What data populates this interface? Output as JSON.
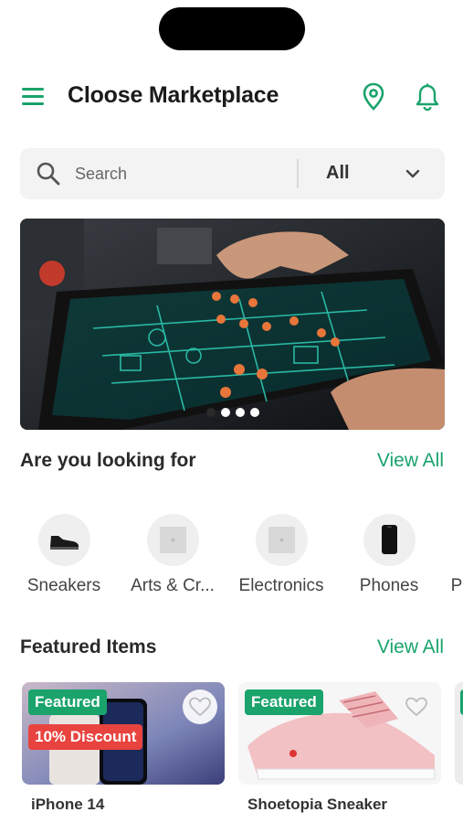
{
  "app": {
    "title": "Cloose Marketplace"
  },
  "search": {
    "placeholder": "Search",
    "category": "All"
  },
  "banner": {
    "slides": 4,
    "active_slide": 1
  },
  "categories_section": {
    "title": "Are you looking for",
    "view_all": "View All",
    "items": [
      {
        "label": "Sneakers",
        "icon": "sneaker-icon"
      },
      {
        "label": "Arts & Cr...",
        "icon": "image-placeholder-icon"
      },
      {
        "label": "Electronics",
        "icon": "image-placeholder-icon"
      },
      {
        "label": "Phones",
        "icon": "phone-icon"
      },
      {
        "label": "P",
        "icon": ""
      }
    ]
  },
  "featured_section": {
    "title": "Featured Items",
    "view_all": "View All",
    "items": [
      {
        "name": "iPhone 14",
        "badge": "Featured",
        "discount": "10% Discount"
      },
      {
        "name": "Shoetopia Sneaker",
        "badge": "Featured"
      }
    ]
  },
  "colors": {
    "accent": "#1aa36b",
    "discount": "#e8433f"
  }
}
